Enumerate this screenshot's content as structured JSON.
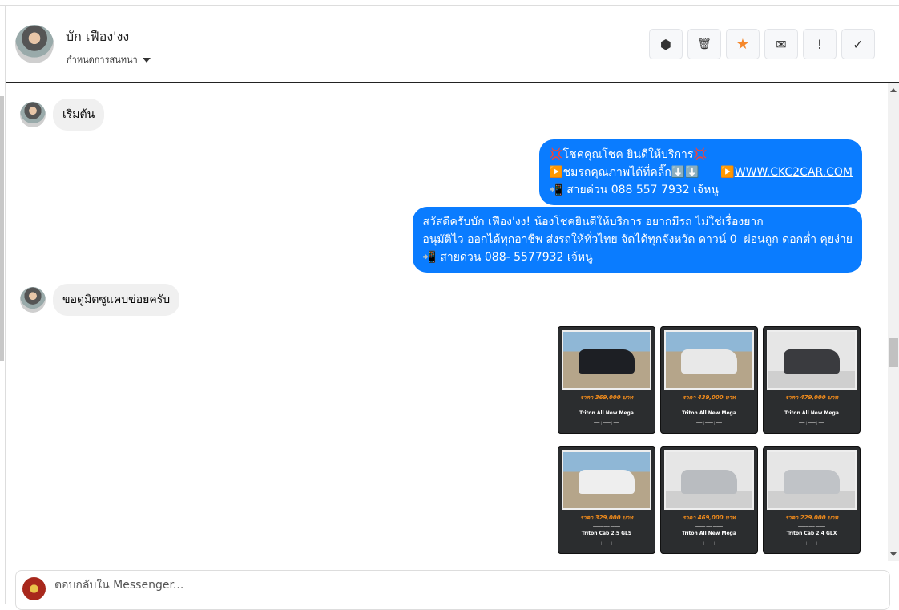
{
  "header": {
    "name": "บัก เฟือง'งง",
    "subtitle": "กำหนดการสนทนา",
    "actions": [
      {
        "icon": "alert-octagon-icon",
        "glyph": "⬢"
      },
      {
        "icon": "trash-icon",
        "glyph": "🗑"
      },
      {
        "icon": "star-icon",
        "glyph": "★",
        "color": "#f5872a"
      },
      {
        "icon": "envelope-icon",
        "glyph": "✉"
      },
      {
        "icon": "exclamation-icon",
        "glyph": "!"
      },
      {
        "icon": "check-icon",
        "glyph": "✓"
      }
    ]
  },
  "messages": [
    {
      "from": "contact",
      "text": "เริ่มต้น"
    },
    {
      "from": "page",
      "line1": "💢โชคคุณโชค ยินดีให้บริการ💢",
      "line2": "▶️ชมรถคุณภาพได้ที่คลิ๊ก⬇️⬇️      ▶️",
      "link": "WWW.CKC2CAR.COM",
      "line3": "📲 สายด่วน 088 557 7932 เจ้หนู"
    },
    {
      "from": "page",
      "text": "สวัสดีครับบัก เฟือง'งง! น้องโชคยินดีให้บริการ อยากมีรถ ไม่ใช่เรื่องยาก\nอนุมัติไว ออกได้ทุกอาชีพ ส่งรถให้ทั่วไทย จัดได้ทุกจังหวัด ดาวน์ 0  ผ่อนถูก ดอกต่ำ คุยง่าย\n📲 สายด่วน 088- 5577932 เจ้หนู"
    },
    {
      "from": "contact",
      "text": "ขอดูมิตซูแคบข่อยครับ"
    }
  ],
  "cars": [
    {
      "price": "ราคา 369,000 บาท",
      "model": "Triton All New Mega",
      "color": "#1d1f24"
    },
    {
      "price": "ราคา 439,000 บาท",
      "model": "Triton All New Mega",
      "color": "#e8e8e8"
    },
    {
      "price": "ราคา 479,000 บาท",
      "model": "Triton All New Mega",
      "color": "#3a3b3f"
    },
    {
      "price": "ราคา 329,000 บาท",
      "model": "Triton Cab 2.5 GLS",
      "color": "#eeeeee"
    },
    {
      "price": "ราคา 469,000 บาท",
      "model": "Triton All New Mega",
      "color": "#b9bcc0"
    },
    {
      "price": "ราคา 229,000 บาท",
      "model": "Triton Cab 2.4 GLX",
      "color": "#c0c3c7"
    }
  ],
  "composer": {
    "placeholder": "ตอบกลับใน Messenger..."
  }
}
